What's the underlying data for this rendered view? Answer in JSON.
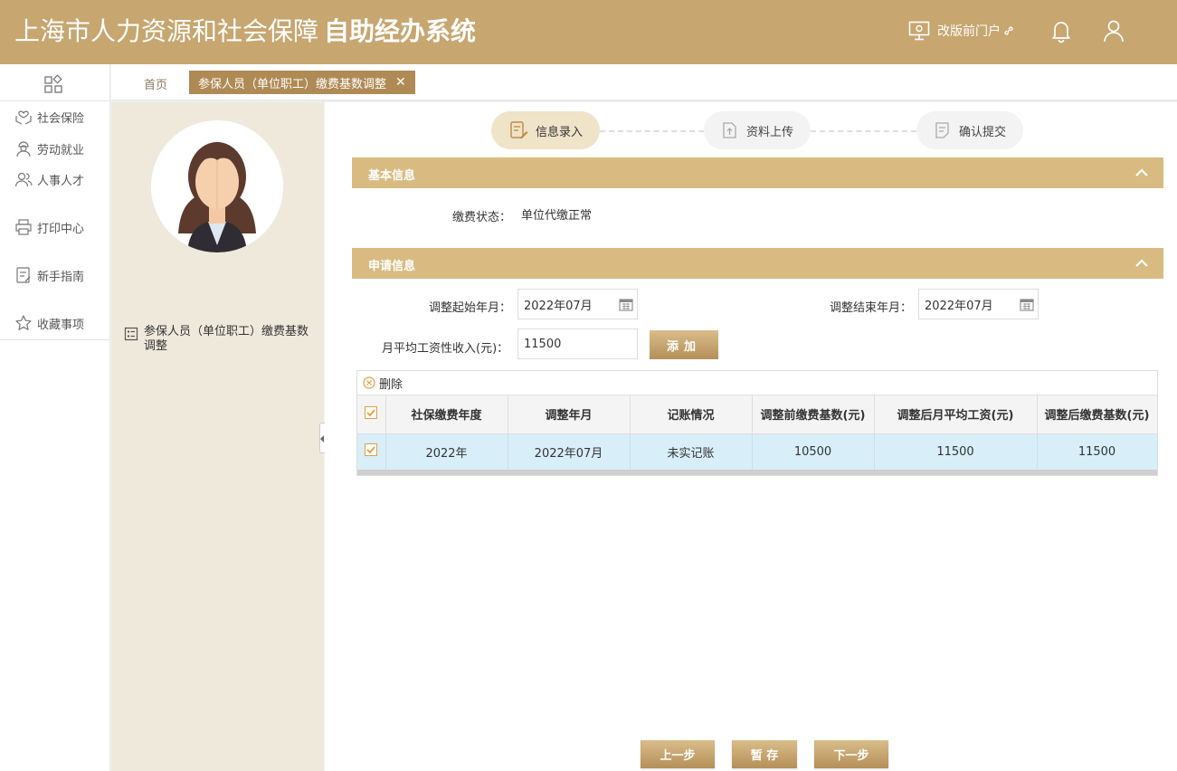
{
  "header": {
    "title_main": "上海市人力资源和社会保障",
    "title_bold": "自助经办系统",
    "legacy_portal": "改版前门户"
  },
  "sidebar": {
    "items": [
      {
        "label": "社会保险",
        "icon": "hands-heart-icon"
      },
      {
        "label": "劳动就业",
        "icon": "worker-icon"
      },
      {
        "label": "人事人才",
        "icon": "people-icon"
      },
      {
        "label": "打印中心",
        "icon": "printer-icon"
      },
      {
        "label": "新手指南",
        "icon": "guide-icon"
      },
      {
        "label": "收藏事项",
        "icon": "star-icon"
      }
    ]
  },
  "tabs": {
    "home": "首页",
    "active": "参保人员（单位职工）缴费基数调整"
  },
  "profile": {
    "item_label": "参保人员（单位职工）缴费基数调整"
  },
  "steps": [
    {
      "label": "信息录入",
      "state": "active"
    },
    {
      "label": "资料上传",
      "state": "pending"
    },
    {
      "label": "确认提交",
      "state": "pending"
    }
  ],
  "basic": {
    "title": "基本信息",
    "status_label": "缴费状态：",
    "status_value": "单位代缴正常"
  },
  "apply": {
    "title": "申请信息",
    "start_label": "调整起始年月：",
    "start_value": "2022年07月",
    "end_label": "调整结束年月：",
    "end_value": "2022年07月",
    "income_label": "月平均工资性收入(元)：",
    "income_value": "11500",
    "add_label": "添加"
  },
  "table": {
    "delete_label": "删除",
    "columns": [
      "社保缴费年度",
      "调整年月",
      "记账情况",
      "调整前缴费基数(元)",
      "调整后月平均工资(元)",
      "调整后缴费基数(元)"
    ],
    "rows": [
      {
        "checked": true,
        "cells": [
          "2022年",
          "2022年07月",
          "未实记账",
          "10500",
          "11500",
          "11500"
        ]
      }
    ]
  },
  "footer": {
    "prev": "上一步",
    "save": "暂 存",
    "next": "下一步"
  },
  "colors": {
    "brand": "#c7a670",
    "panel_head": "#d9bb81",
    "row_selected": "#d8eef9"
  }
}
